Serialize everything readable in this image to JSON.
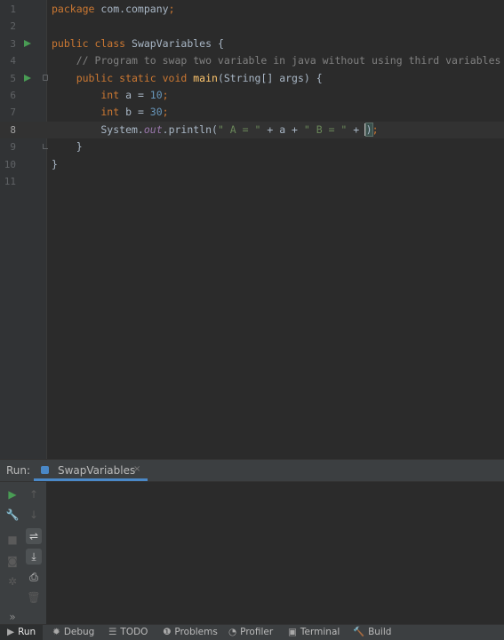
{
  "editor": {
    "lines": [
      {
        "n": "1",
        "tokens": [
          {
            "t": "package ",
            "c": "kw"
          },
          {
            "t": "com.company",
            "c": ""
          },
          {
            "t": ";",
            "c": "kw"
          }
        ]
      },
      {
        "n": "2",
        "tokens": []
      },
      {
        "n": "3",
        "tokens": [
          {
            "t": "public class ",
            "c": "kw"
          },
          {
            "t": "SwapVariables {",
            "c": ""
          }
        ],
        "run": true
      },
      {
        "n": "4",
        "tokens": [
          {
            "t": "    // Program to swap two variable in java without using third variables",
            "c": "cm"
          }
        ]
      },
      {
        "n": "5",
        "tokens": [
          {
            "t": "    public static void ",
            "c": "kw"
          },
          {
            "t": "main",
            "c": "fn"
          },
          {
            "t": "(String[] args) {",
            "c": ""
          }
        ],
        "run": true,
        "fold": "open"
      },
      {
        "n": "6",
        "tokens": [
          {
            "t": "        int ",
            "c": "kw"
          },
          {
            "t": "a = ",
            "c": ""
          },
          {
            "t": "10",
            "c": "num"
          },
          {
            "t": ";",
            "c": "kw"
          }
        ]
      },
      {
        "n": "7",
        "tokens": [
          {
            "t": "        int ",
            "c": "kw"
          },
          {
            "t": "b = ",
            "c": ""
          },
          {
            "t": "30",
            "c": "num"
          },
          {
            "t": ";",
            "c": "kw"
          }
        ]
      },
      {
        "n": "8",
        "tokens": [
          {
            "t": "        System.",
            "c": ""
          },
          {
            "t": "out",
            "c": "fld"
          },
          {
            "t": ".println(",
            "c": ""
          },
          {
            "t": "\" A = \"",
            "c": "st"
          },
          {
            "t": " + a + ",
            "c": ""
          },
          {
            "t": "\" B = \"",
            "c": "st"
          },
          {
            "t": " + ",
            "c": ""
          },
          {
            "t": "CARET",
            "c": "caret"
          },
          {
            "t": ")",
            "c": "paren"
          },
          {
            "t": ";",
            "c": "kw"
          }
        ],
        "current": true
      },
      {
        "n": "9",
        "tokens": [
          {
            "t": "    }",
            "c": ""
          }
        ],
        "fold": "end"
      },
      {
        "n": "10",
        "tokens": [
          {
            "t": "}",
            "c": ""
          }
        ]
      },
      {
        "n": "11",
        "tokens": []
      }
    ]
  },
  "run_panel": {
    "label": "Run:",
    "tab_label": "SwapVariables",
    "tab_close": "×"
  },
  "run_tools": [
    {
      "name": "rerun-icon",
      "glyph": "▶",
      "color": "#499c54"
    },
    {
      "name": "scroll-up-icon",
      "glyph": "↑",
      "color": "#5a5a5a"
    },
    {
      "name": "wrench-icon",
      "glyph": "🔧",
      "color": "#8a8a8a"
    },
    {
      "name": "scroll-down-icon",
      "glyph": "↓",
      "color": "#5a5a5a"
    },
    {
      "name": "stop-icon",
      "glyph": "■",
      "color": "#5a5a5a"
    },
    {
      "name": "soft-wrap-icon",
      "glyph": "⇌",
      "color": "#cfcfcf"
    },
    {
      "name": "camera-icon",
      "glyph": "◙",
      "color": "#5a5a5a"
    },
    {
      "name": "scroll-to-end-icon",
      "glyph": "⤓",
      "color": "#cfcfcf"
    },
    {
      "name": "bug-disabled-icon",
      "glyph": "✲",
      "color": "#5a5a5a"
    },
    {
      "name": "print-icon",
      "glyph": "⎙",
      "color": "#cfcfcf"
    },
    {
      "name": "trash-icon",
      "glyph": "🗑",
      "color": "#5a5a5a"
    },
    {
      "name": "more-icon",
      "glyph": "»",
      "color": "#8a8a8a"
    }
  ],
  "status_bar": [
    {
      "icon": "▶",
      "icon_name": "run-icon",
      "label": "Run",
      "active": true
    },
    {
      "icon": "✹",
      "icon_name": "debug-icon",
      "label": "Debug"
    },
    {
      "icon": "☰",
      "icon_name": "todo-icon",
      "label": "TODO"
    },
    {
      "icon": "❶",
      "icon_name": "problems-icon",
      "label": "Problems"
    },
    {
      "icon": "◔",
      "icon_name": "profiler-icon",
      "label": "Profiler"
    },
    {
      "icon": "▣",
      "icon_name": "terminal-icon",
      "label": "Terminal"
    },
    {
      "icon": "🔨",
      "icon_name": "build-icon",
      "label": "Build"
    }
  ]
}
